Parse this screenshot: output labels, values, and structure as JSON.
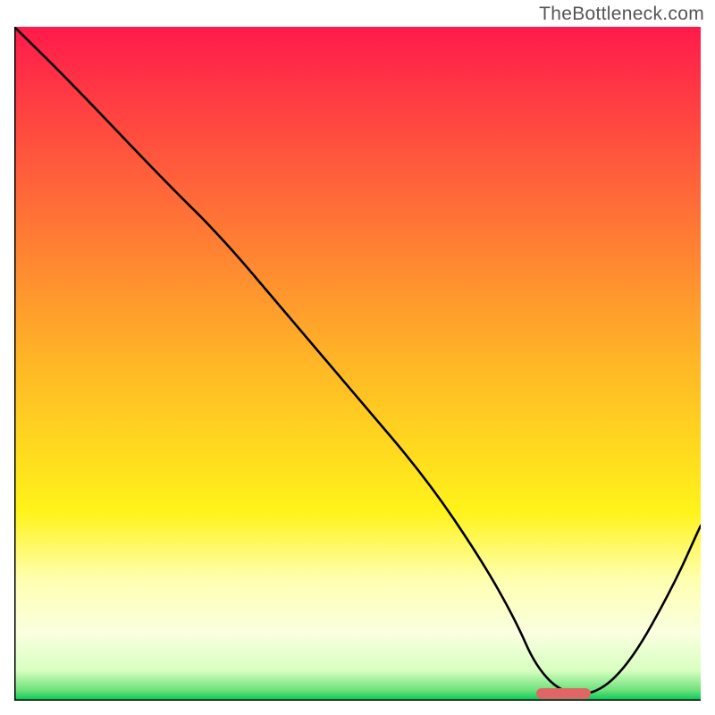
{
  "watermark": "TheBottleneck.com",
  "chart_data": {
    "type": "line",
    "title": "",
    "xlabel": "",
    "ylabel": "",
    "xlim": [
      0,
      100
    ],
    "ylim": [
      0,
      100
    ],
    "grid": false,
    "legend": false,
    "background": {
      "type": "vertical-gradient",
      "stops": [
        {
          "pos": 0.0,
          "color": "#ff1a4b"
        },
        {
          "pos": 0.5,
          "color": "#ffb726"
        },
        {
          "pos": 0.72,
          "color": "#fff31a"
        },
        {
          "pos": 0.82,
          "color": "#ffffb0"
        },
        {
          "pos": 0.9,
          "color": "#faffe0"
        },
        {
          "pos": 0.955,
          "color": "#d8ffc0"
        },
        {
          "pos": 0.985,
          "color": "#6be07a"
        },
        {
          "pos": 1.0,
          "color": "#00c853"
        }
      ]
    },
    "series": [
      {
        "name": "bottleneck-curve",
        "color": "#000000",
        "x": [
          0,
          8,
          22,
          30,
          40,
          50,
          60,
          68,
          73,
          76,
          80,
          85,
          90,
          96,
          100
        ],
        "y": [
          100,
          92,
          77,
          69,
          57,
          45,
          33,
          21,
          12,
          5,
          1,
          1,
          6,
          17,
          26
        ]
      }
    ],
    "marker": {
      "name": "optimal-range",
      "color": "#e06666",
      "x_start": 76,
      "x_end": 84,
      "y": 1
    }
  }
}
